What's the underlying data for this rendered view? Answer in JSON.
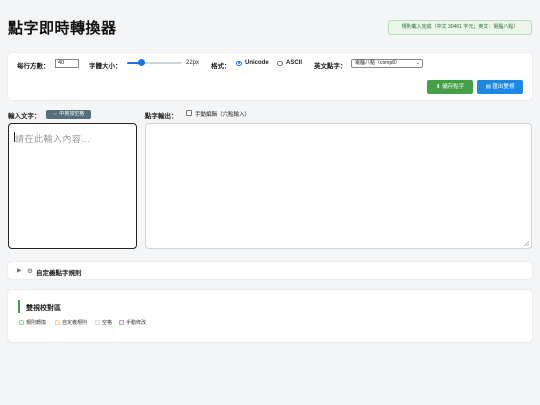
{
  "header": {
    "title": "點字即時轉換器",
    "status": "規則載入完成（中文 30461 字元；英文：電腦八點）"
  },
  "settings": {
    "per_row_label": "每行方數：",
    "per_row_value": "40",
    "font_size_label": "字體大小：",
    "font_size_value": "22px",
    "font_size_fraction": 0.25,
    "format_label": "格式：",
    "format_options": [
      {
        "label": "Unicode",
        "selected": true
      },
      {
        "label": "ASCII",
        "selected": false
      }
    ],
    "english_braille_label": "英文點字：",
    "english_braille_selected": "電腦八點（comp8）",
    "save_button": "儲存點字",
    "export_button": "匯出雙視"
  },
  "input": {
    "label": "輸入文字：",
    "space_button": "中英加空格",
    "placeholder": "請在此輸入內容..."
  },
  "output": {
    "label": "點字輸出：",
    "manual_edit_label": "手動編輯（六點輸入）",
    "manual_edit_checked": false
  },
  "custom_rules": {
    "label": "自定義點字規則"
  },
  "proofreading": {
    "title": "雙視校對區",
    "legend": [
      {
        "label": "規則轉換",
        "color": "#e8f5e9",
        "border": "#a5d6a7"
      },
      {
        "label": "自定義規則",
        "color": "#fff8e1",
        "border": "#ffcc80"
      },
      {
        "label": "空格",
        "color": "#f5f5f5",
        "border": "#e0e0e0"
      },
      {
        "label": "手動修改",
        "color": "#f3e5f5",
        "border": "#ce93d8"
      }
    ]
  },
  "icons": {
    "save": "download-icon",
    "export": "document-icon",
    "space": "swap-arrows-icon",
    "gear": "gear-icon",
    "expand": "triangle-right-icon"
  },
  "colors": {
    "accent_blue": "#1e88e5",
    "accent_green": "#43a047",
    "space_button": "#546e7a"
  }
}
